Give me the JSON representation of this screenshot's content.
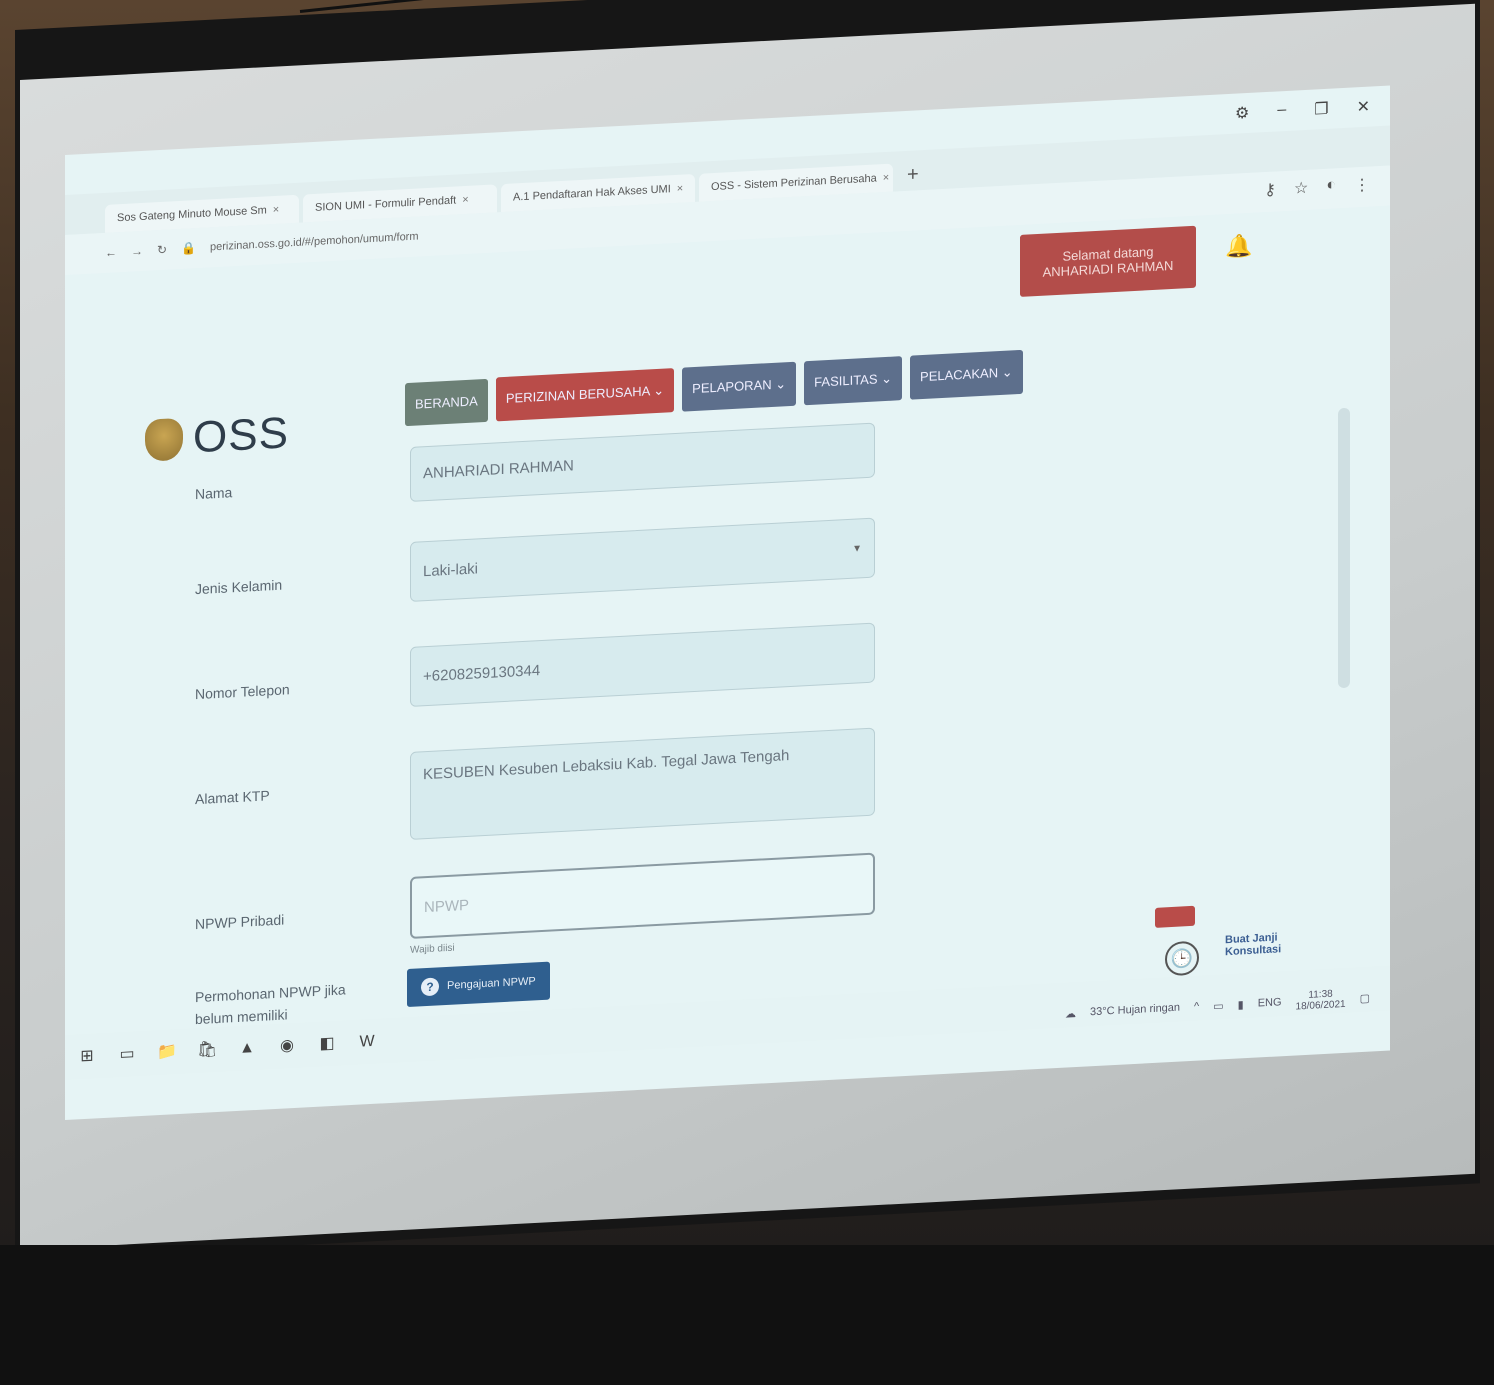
{
  "browser": {
    "tabs": [
      {
        "label": "Sos Gateng Minuto Mouse Sm"
      },
      {
        "label": "SION UMI - Formulir Pendaft"
      },
      {
        "label": "A.1 Pendaftaran Hak Akses UMI"
      },
      {
        "label": "OSS - Sistem Perizinan Berusaha"
      }
    ],
    "new_tab": "+",
    "url": "perizinan.oss.go.id/#/pemohon/umum/form"
  },
  "header": {
    "welcome_line1": "Selamat datang",
    "welcome_line2": "ANHARIADI RAHMAN",
    "logo_text": "OSS"
  },
  "nav": [
    {
      "label": "BERANDA",
      "dropdown": false
    },
    {
      "label": "PERIZINAN BERUSAHA",
      "dropdown": true
    },
    {
      "label": "PELAPORAN",
      "dropdown": true
    },
    {
      "label": "FASILITAS",
      "dropdown": true
    },
    {
      "label": "PELACAKAN",
      "dropdown": true
    }
  ],
  "form": {
    "nama_label": "Nama",
    "nama_value": "ANHARIADI RAHMAN",
    "gender_label": "Jenis Kelamin",
    "gender_value": "Laki-laki",
    "phone_label": "Nomor Telepon",
    "phone_value": "+6208259130344",
    "address_label": "Alamat KTP",
    "address_value": "KESUBEN Kesuben Lebaksiu Kab. Tegal Jawa Tengah",
    "npwp_label": "NPWP Pribadi",
    "npwp_placeholder": "NPWP",
    "npwp_help": "Wajib diisi",
    "npwp_request_label": "Permohonan NPWP jika belum memiliki",
    "npwp_request_button": "Pengajuan NPWP"
  },
  "side": {
    "consult_label": "Buat Janji Konsultasi"
  },
  "taskbar": {
    "weather": "33°C Hujan ringan",
    "lang": "ENG",
    "time": "11:38",
    "date": "18/06/2021"
  }
}
